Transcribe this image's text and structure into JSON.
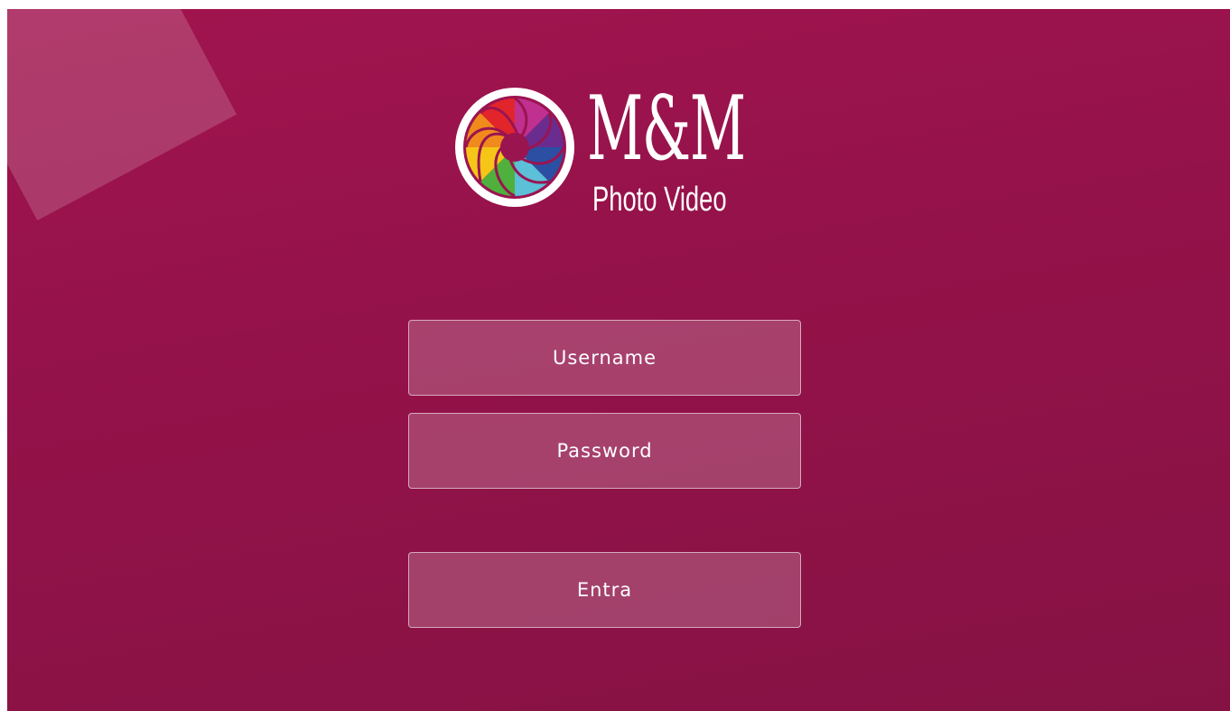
{
  "brand": {
    "title": "M&M",
    "subtitle": "Photo Video",
    "logo_icon": "camera-aperture-icon"
  },
  "login": {
    "username_placeholder": "Username",
    "password_placeholder": "Password",
    "submit_label": "Entra"
  },
  "colors": {
    "background": "#9a1450",
    "field_border": "#ffffff",
    "text": "#ffffff"
  }
}
